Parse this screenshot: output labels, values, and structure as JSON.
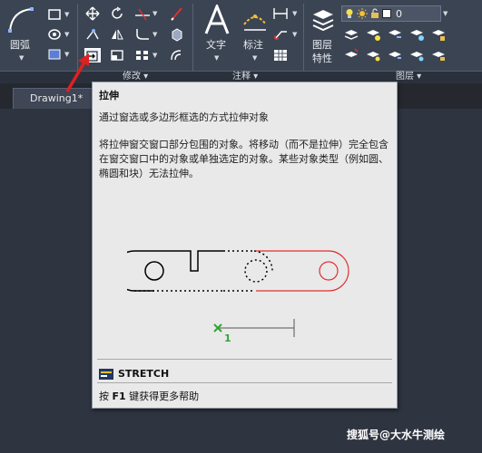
{
  "ribbon": {
    "draw_panel": {
      "arc_label": "圆弧"
    },
    "modify_panel": {
      "label": "修改"
    },
    "annotation_panel": {
      "label": "注释",
      "text_label": "文字",
      "dimension_label": "标注"
    },
    "layers_panel": {
      "label": "图层",
      "layer_props_line1": "图层",
      "layer_props_line2": "特性",
      "current_layer": "0"
    }
  },
  "doc_tab": {
    "name": "Drawing1*"
  },
  "tooltip": {
    "title": "拉伸",
    "summary": "通过窗选或多边形框选的方式拉伸对象",
    "description": "将拉伸窗交窗口部分包围的对象。将移动（而不是拉伸）完全包含在窗交窗口中的对象或单独选定的对象。某些对象类型（例如圆、椭圆和块）无法拉伸。",
    "illustration": {
      "point_label": "1"
    },
    "command_name": "STRETCH",
    "help_prefix": "按 ",
    "help_key": "F1",
    "help_suffix": " 键获得更多帮助"
  },
  "watermark": "搜狐号@大水牛测绘",
  "colors": {
    "ribbon_bg": "#3b4453",
    "canvas_bg": "#2f3441",
    "tooltip_bg": "#e9e9e9",
    "accent_red": "#e03030",
    "point_green": "#2ea82e"
  }
}
